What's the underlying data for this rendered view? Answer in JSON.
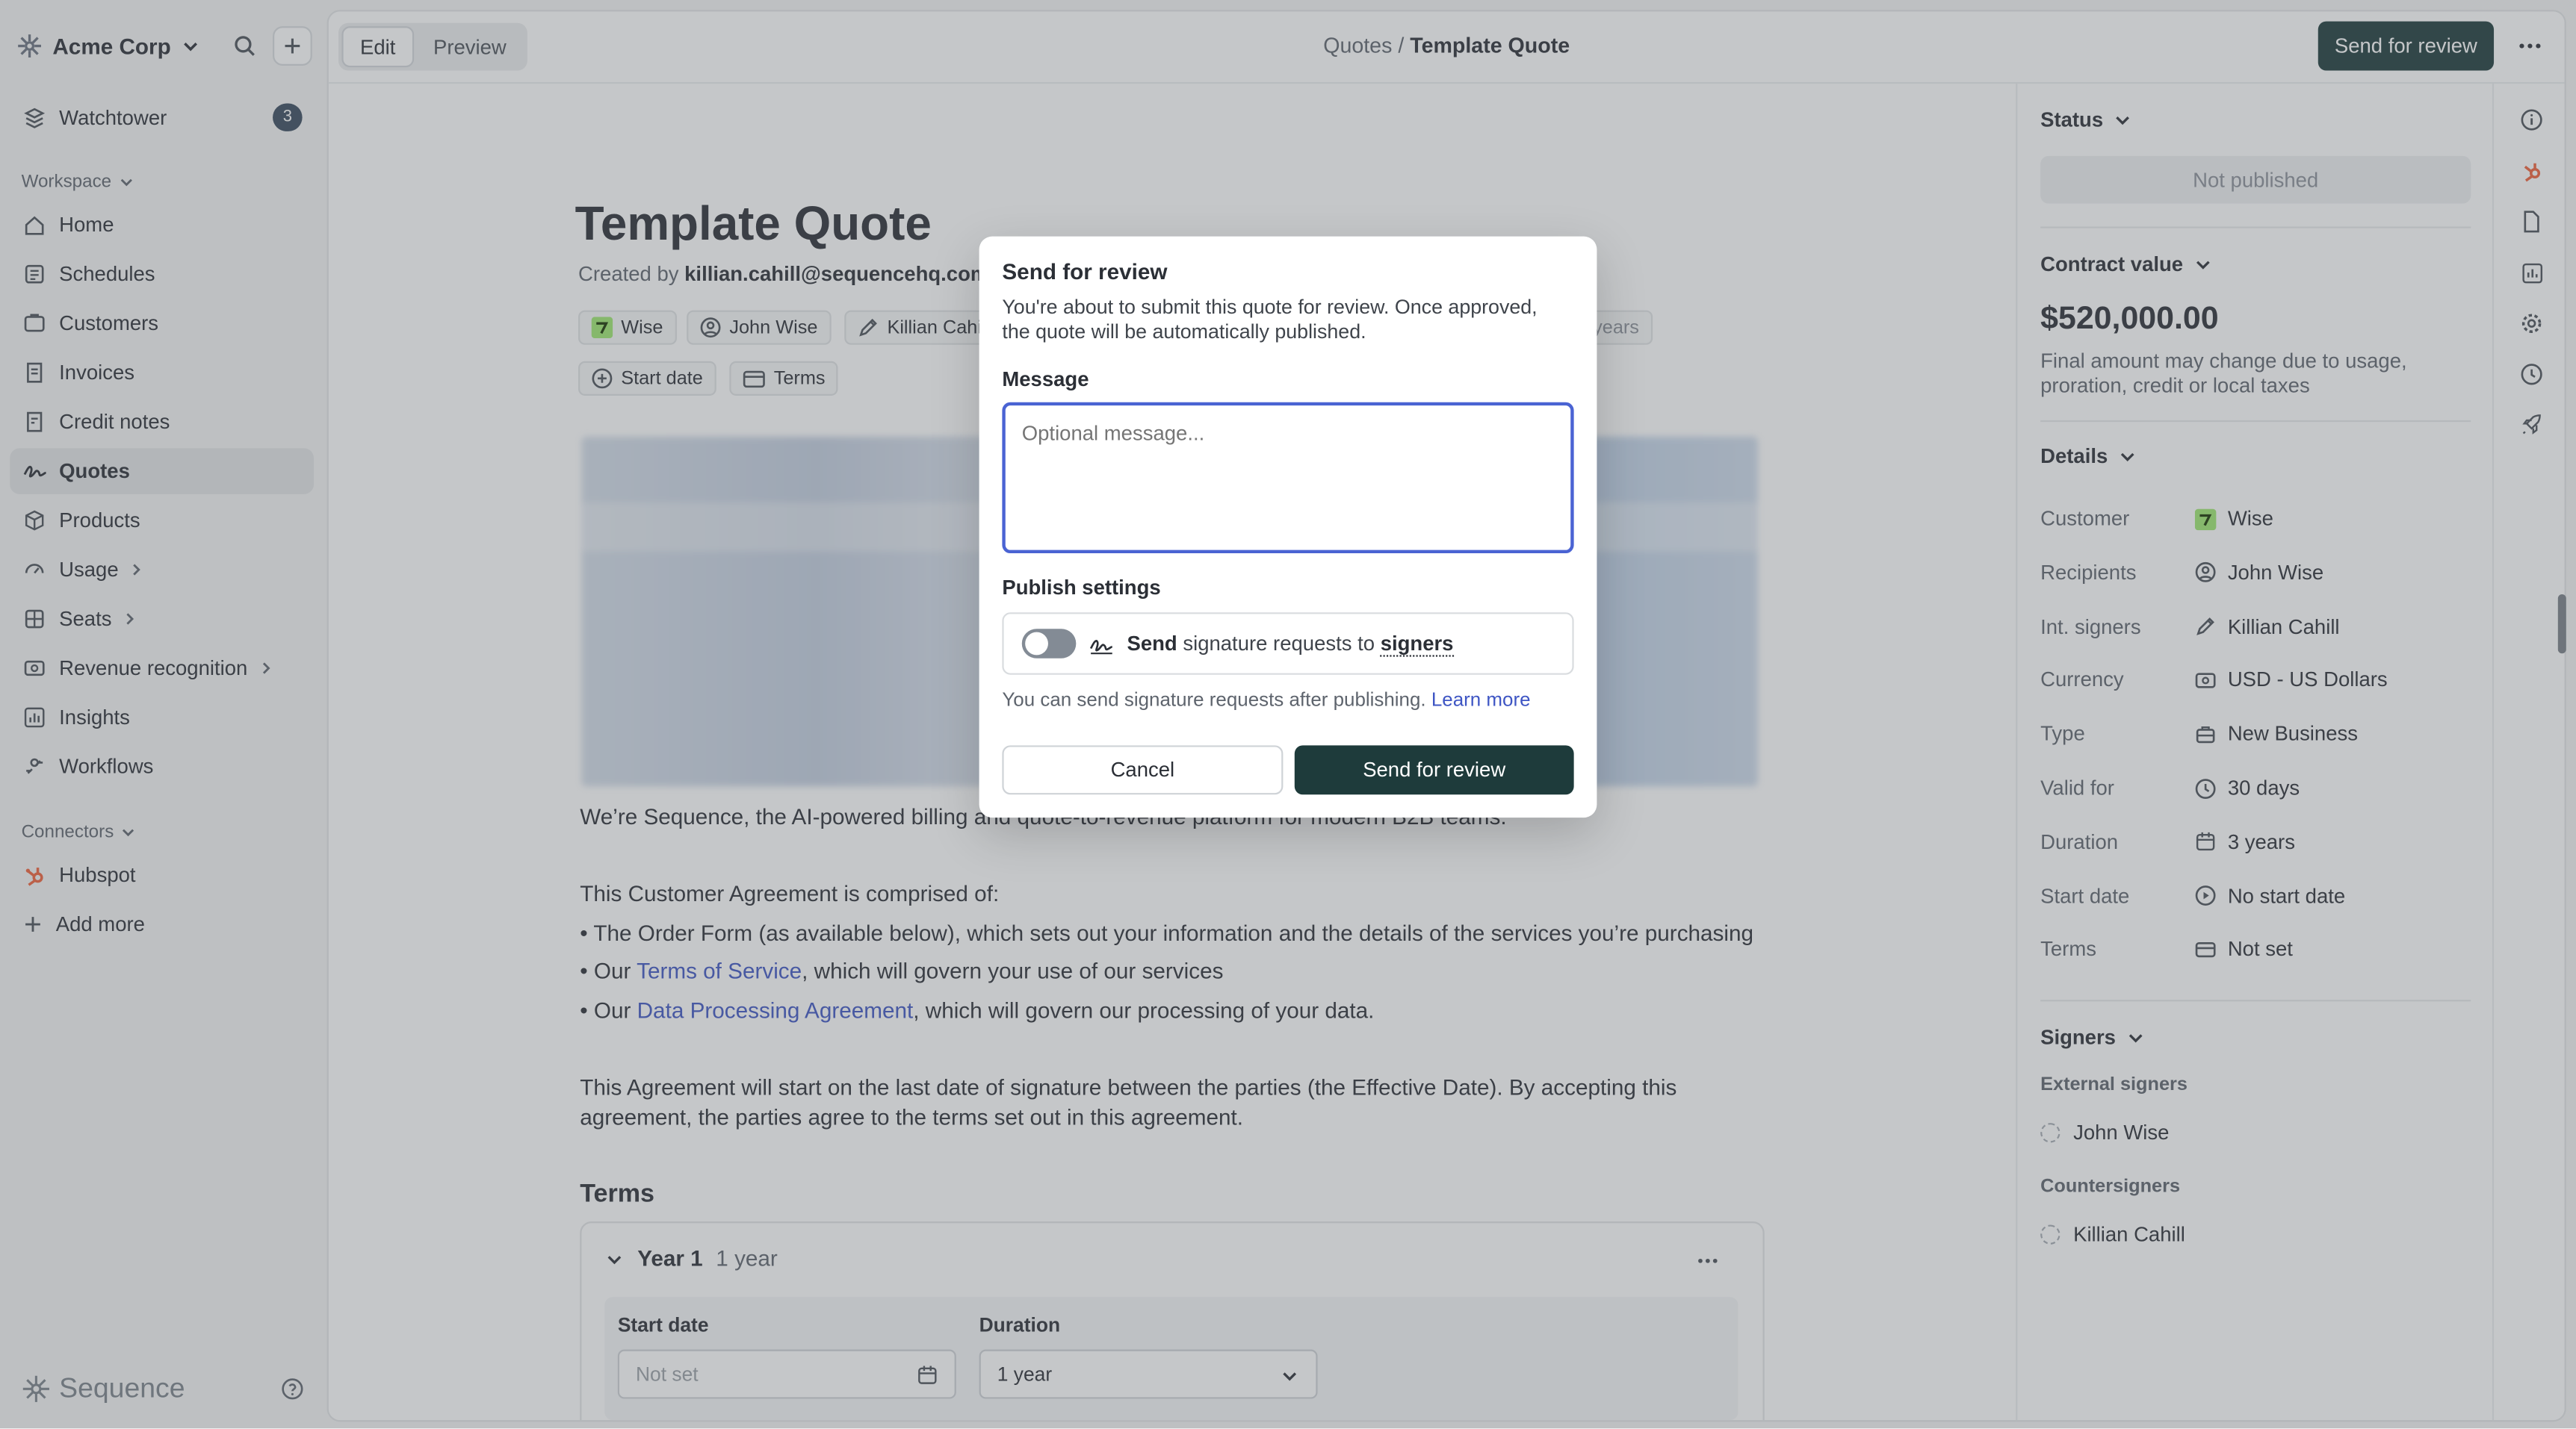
{
  "sidebar": {
    "org_name": "Acme Corp",
    "watchtower": {
      "label": "Watchtower",
      "count": "3"
    },
    "workspace_label": "Workspace",
    "items": [
      {
        "label": "Home",
        "icon": "home-icon"
      },
      {
        "label": "Schedules",
        "icon": "schedule-icon"
      },
      {
        "label": "Customers",
        "icon": "customers-icon"
      },
      {
        "label": "Invoices",
        "icon": "invoice-icon"
      },
      {
        "label": "Credit notes",
        "icon": "credit-note-icon"
      },
      {
        "label": "Quotes",
        "icon": "quote-icon",
        "active": true
      },
      {
        "label": "Products",
        "icon": "product-icon"
      },
      {
        "label": "Usage",
        "icon": "usage-icon"
      },
      {
        "label": "Seats",
        "icon": "seats-icon"
      },
      {
        "label": "Revenue recognition",
        "icon": "revenue-icon"
      },
      {
        "label": "Insights",
        "icon": "insights-icon"
      },
      {
        "label": "Workflows",
        "icon": "workflows-icon"
      }
    ],
    "connectors_label": "Connectors",
    "connectors": [
      {
        "label": "Hubspot"
      },
      {
        "label": "Add more"
      }
    ],
    "brand": "Sequence"
  },
  "toolbar": {
    "edit_label": "Edit",
    "preview_label": "Preview",
    "breadcrumb_parent": "Quotes",
    "breadcrumb_sep": " / ",
    "breadcrumb_current": "Template Quote",
    "send_for_review_label": "Send for review"
  },
  "document": {
    "title": "Template Quote",
    "created_by_prefix": "Created by ",
    "created_by": "killian.cahill@sequencehq.com",
    "chips": {
      "customer": "Wise",
      "recipient": "John Wise",
      "signer": "Killian Cahill",
      "duration": "3 years",
      "start_date": "Start date",
      "terms": "Terms"
    },
    "intro": "We’re Sequence, the AI-powered billing and quote-to-revenue platform for modern B2B teams.",
    "agreement_intro": "This Customer Agreement is comprised of:",
    "bullet_1": "• The Order Form (as available below), which sets out your information and the details of the services you’re purchasing",
    "bullet_2_pre": "• Our ",
    "bullet_2_link": "Terms of Service",
    "bullet_2_post": ", which will govern your use of our services",
    "bullet_3_pre": "• Our ",
    "bullet_3_link": "Data Processing Agreement",
    "bullet_3_post": ", which will govern our processing of your data.",
    "agreement_para_1": "This Agreement will start on the last date of signature between the parties (the Effective Date). By accepting this",
    "agreement_para_2": "agreement, the parties agree to the terms set out in this agreement.",
    "terms_heading": "Terms",
    "year": {
      "title": "Year 1",
      "subtitle": "1 year",
      "start_date_label": "Start date",
      "start_date_placeholder": "Not set",
      "duration_label": "Duration",
      "duration_value": "1 year"
    }
  },
  "details_panel": {
    "status_label": "Status",
    "status_value": "Not published",
    "contract_value_label": "Contract value",
    "contract_value": "$520,000.00",
    "contract_note_1": "Final amount may change due to usage,",
    "contract_note_2": "proration, credit or local taxes",
    "details_label": "Details",
    "rows": [
      {
        "key": "Customer",
        "value": "Wise",
        "icon": "wise-logo-icon"
      },
      {
        "key": "Recipients",
        "value": "John Wise",
        "icon": "user-circle-icon"
      },
      {
        "key": "Int. signers",
        "value": "Killian Cahill",
        "icon": "pen-icon"
      },
      {
        "key": "Currency",
        "value": "USD - US Dollars",
        "icon": "currency-icon"
      },
      {
        "key": "Type",
        "value": "New Business",
        "icon": "briefcase-icon"
      },
      {
        "key": "Valid for",
        "value": "30 days",
        "icon": "clock-icon"
      },
      {
        "key": "Duration",
        "value": "3 years",
        "icon": "calendar-icon"
      },
      {
        "key": "Start date",
        "value": "No start date",
        "icon": "play-circle-icon"
      },
      {
        "key": "Terms",
        "value": "Not set",
        "icon": "card-icon"
      }
    ],
    "signers_label": "Signers",
    "external_signers_label": "External signers",
    "external_signer": "John Wise",
    "countersigners_label": "Countersigners",
    "countersigner": "Killian Cahill"
  },
  "modal": {
    "title": "Send for review",
    "description": "You're about to submit this quote for review. Once approved, the quote will be automatically published.",
    "message_label": "Message",
    "message_placeholder": "Optional message...",
    "publish_settings_label": "Publish settings",
    "switch_bold": "Send",
    "switch_text": " signature requests to ",
    "switch_link": "signers",
    "hint": "You can send signature requests after publishing. ",
    "hint_link": "Learn more",
    "cancel_label": "Cancel",
    "submit_label": "Send for review"
  },
  "colors": {
    "primary": "#1e3b3b",
    "link": "#3f56c4",
    "focus": "#4a63d3",
    "badge": "#3a4b5e"
  }
}
